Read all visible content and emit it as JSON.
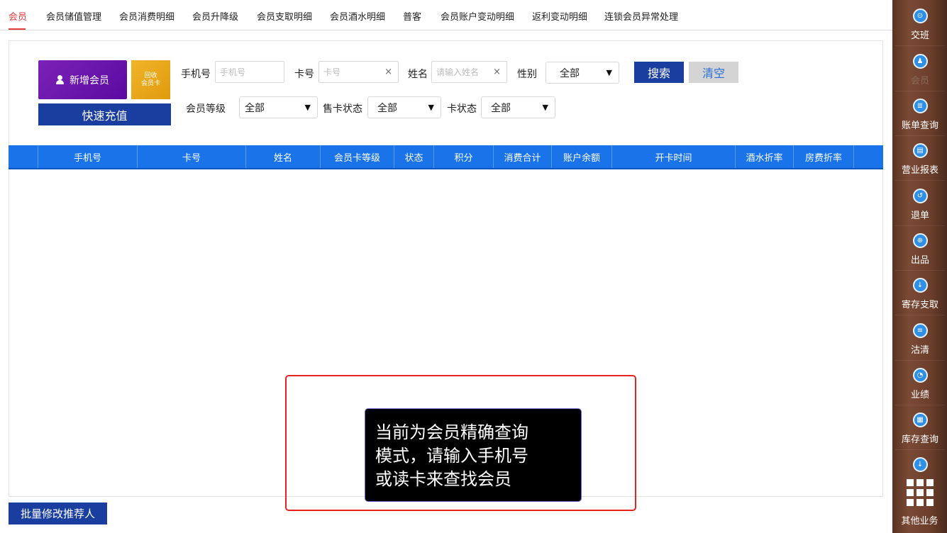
{
  "tabs": [
    {
      "label": "会员",
      "active": true
    },
    {
      "label": "会员储值管理"
    },
    {
      "label": "会员消费明细"
    },
    {
      "label": "会员升降级"
    },
    {
      "label": "会员支取明细"
    },
    {
      "label": "会员酒水明细"
    },
    {
      "label": "普客"
    },
    {
      "label": "会员账户变动明细"
    },
    {
      "label": "返利变动明细"
    },
    {
      "label": "连锁会员异常处理"
    }
  ],
  "actions": {
    "add_member": "新增会员",
    "recycle_line1": "回收",
    "recycle_line2": "会员卡",
    "quick_recharge": "快速充值",
    "batch_edit": "批量修改推荐人"
  },
  "filters": {
    "phone_label": "手机号",
    "phone_placeholder": "手机号",
    "card_label": "卡号",
    "card_placeholder": "卡号",
    "name_label": "姓名",
    "name_placeholder": "请输入姓名",
    "gender_label": "性别",
    "gender_value": "全部",
    "level_label": "会员等级",
    "level_value": "全部",
    "sale_status_label": "售卡状态",
    "sale_status_value": "全部",
    "card_status_label": "卡状态",
    "card_status_value": "全部",
    "clear_symbol": "×",
    "arrow_symbol": "▼",
    "search_button": "搜索",
    "clear_button": "清空"
  },
  "table": {
    "columns": [
      "手机号",
      "卡号",
      "姓名",
      "会员卡等级",
      "状态",
      "积分",
      "消费合计",
      "账户余额",
      "开卡时间",
      "酒水折率",
      "房费折率"
    ],
    "rows": []
  },
  "toast": {
    "line1": "当前为会员精确查询",
    "line2": "模式，请输入手机号",
    "line3": "或读卡来查找会员"
  },
  "sidebar": {
    "items": [
      {
        "label": "交班",
        "icon": "handover-icon",
        "glyph": "⊙"
      },
      {
        "label": "会员",
        "icon": "member-icon",
        "glyph": "♟",
        "active": true
      },
      {
        "label": "账单查询",
        "icon": "bill-icon",
        "glyph": "≣"
      },
      {
        "label": "营业报表",
        "icon": "report-icon",
        "glyph": "▤"
      },
      {
        "label": "退单",
        "icon": "refund-icon",
        "glyph": "↺"
      },
      {
        "label": "出品",
        "icon": "product-icon",
        "glyph": "⊕"
      },
      {
        "label": "寄存支取",
        "icon": "storage-icon",
        "glyph": "↓"
      },
      {
        "label": "沽清",
        "icon": "soldout-icon",
        "glyph": "≡"
      },
      {
        "label": "业绩",
        "icon": "performance-icon",
        "glyph": "◔"
      },
      {
        "label": "库存查询",
        "icon": "inventory-icon",
        "glyph": "▦"
      },
      {
        "label": "",
        "icon": "download-icon",
        "glyph": "↓"
      }
    ],
    "more_label": "其他业务"
  },
  "colors": {
    "accent_red": "#e03c3c",
    "primary_blue": "#1a3ea0",
    "table_header_blue": "#1a73e8",
    "add_purple": "#6a16ac",
    "recycle_orange": "#eaa61c",
    "sidebar_brown": "#6b3e2b"
  }
}
